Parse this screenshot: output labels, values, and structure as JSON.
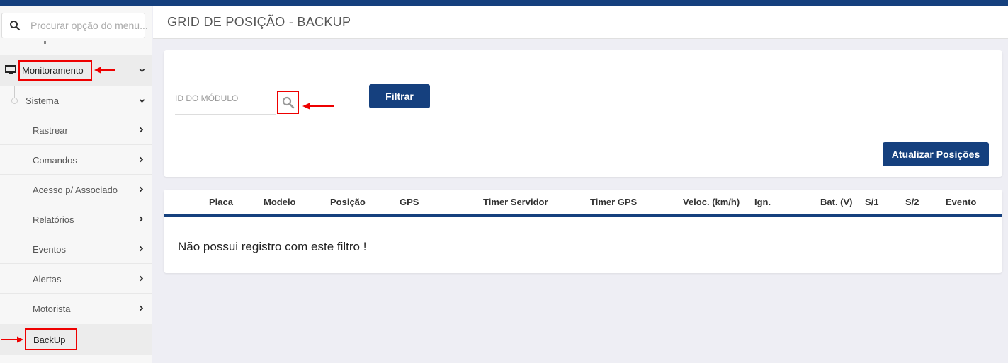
{
  "search": {
    "placeholder": "Procurar opção do menu..."
  },
  "sidebar": {
    "monitoramento_label": "Monitoramento",
    "sistema_label": "Sistema",
    "items": [
      {
        "label": "Rastrear"
      },
      {
        "label": "Comandos"
      },
      {
        "label": "Acesso p/ Associado"
      },
      {
        "label": "Relatórios"
      },
      {
        "label": "Eventos"
      },
      {
        "label": "Alertas"
      },
      {
        "label": "Motorista"
      }
    ],
    "backup_label": "BackUp"
  },
  "page": {
    "title": "GRID DE POSIÇÃO - BACKUP"
  },
  "filter": {
    "field_label": "ID DO MÓDULO",
    "filter_button": "Filtrar",
    "update_button": "Atualizar Posições"
  },
  "table": {
    "columns": [
      "Placa",
      "Modelo",
      "Posição",
      "GPS",
      "Timer Servidor",
      "Timer GPS",
      "Veloc. (km/h)",
      "Ign.",
      "Bat. (V)",
      "S/1",
      "S/2",
      "Evento"
    ],
    "empty_message": "Não possui registro com este filtro !"
  },
  "colors": {
    "brand": "#15407e",
    "highlight": "#ee0000"
  },
  "icons": [
    "search-icon",
    "monitor-icon",
    "chevron-down-icon",
    "chevron-right-icon",
    "arrow-icon"
  ]
}
